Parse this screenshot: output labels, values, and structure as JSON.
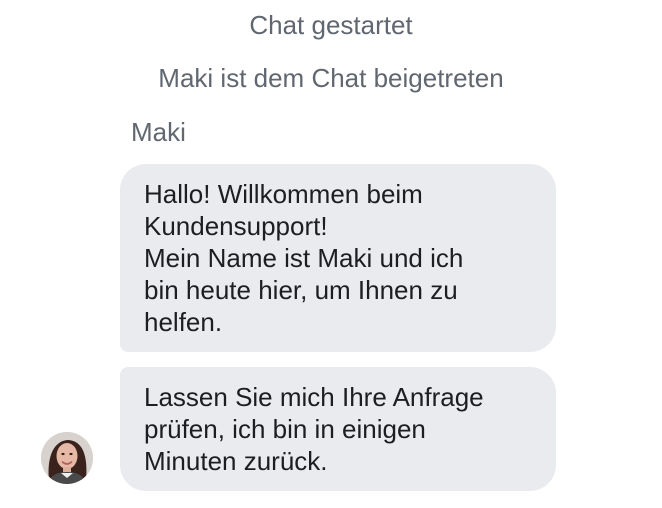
{
  "chat": {
    "system_messages": [
      "Chat gestartet",
      "Maki ist dem Chat beigetreten"
    ],
    "agent_name": "Maki",
    "messages": [
      {
        "lines": [
          "Hallo! Willkommen beim",
          "Kundensupport!",
          "Mein Name ist Maki und ich",
          "bin heute hier, um Ihnen zu",
          "helfen."
        ]
      },
      {
        "lines": [
          "Lassen Sie mich Ihre Anfrage",
          "prüfen, ich bin in einigen",
          "Minuten zurück."
        ]
      }
    ],
    "avatar_icon": "agent-avatar-photo"
  }
}
